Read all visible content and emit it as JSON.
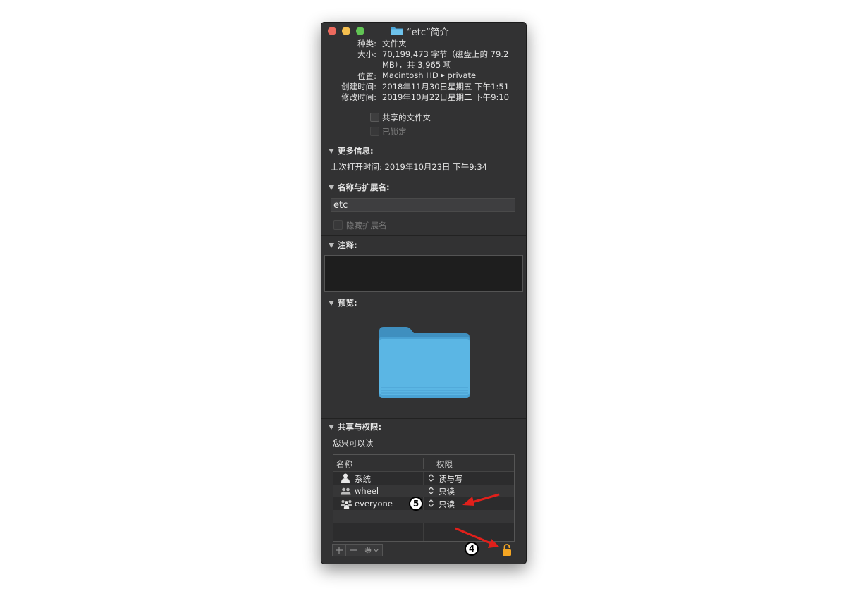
{
  "window": {
    "title": "“etc”简介"
  },
  "general": {
    "kind_label": "种类:",
    "kind_value": "文件夹",
    "size_label": "大小:",
    "size_value_line1": "70,199,473 字节（磁盘上的 79.2",
    "size_value_line2": "MB），共 3,965 项",
    "where_label": "位置:",
    "where_disk": "Macintosh HD",
    "where_folder": "private",
    "created_label": "创建时间:",
    "created_value": "2018年11月30日星期五 下午1:51",
    "modified_label": "修改时间:",
    "modified_value": "2019年10月22日星期二 下午9:10",
    "shared_folder": "共享的文件夹",
    "locked": "已锁定"
  },
  "more_info": {
    "header": "更多信息:",
    "last_opened": "上次打开时间: 2019年10月23日 下午9:34"
  },
  "name_ext": {
    "header": "名称与扩展名:",
    "name_value": "etc",
    "hide_ext": "隐藏扩展名"
  },
  "comments": {
    "header": "注释:"
  },
  "preview": {
    "header": "预览:"
  },
  "sharing": {
    "header": "共享与权限:",
    "status": "您只可以读",
    "col_name": "名称",
    "col_priv": "权限",
    "rows": [
      {
        "name": "系统",
        "priv": "读与写",
        "icon": "single-user-icon"
      },
      {
        "name": "wheel",
        "priv": "只读",
        "icon": "group-icon"
      },
      {
        "name": "everyone",
        "priv": "只读",
        "icon": "everyone-icon"
      }
    ]
  },
  "annotations": {
    "badge_5": "5",
    "badge_4": "4",
    "arrow_color": "#e0201b"
  },
  "colors": {
    "folder_blue": "#57b3e2",
    "lock_orange": "#f5a623"
  }
}
